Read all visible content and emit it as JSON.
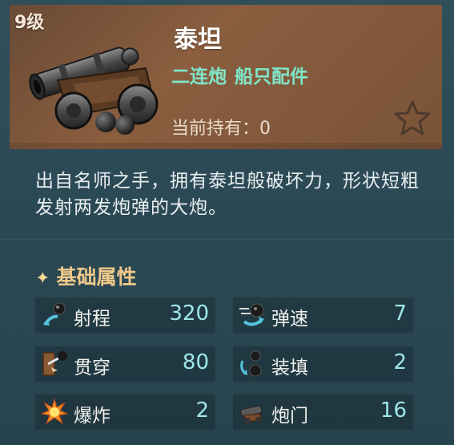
{
  "item": {
    "level": "9级",
    "name": "泰坦",
    "tags": [
      "二连炮",
      "船只配件"
    ],
    "owned_label": "当前持有：",
    "owned_value": "0"
  },
  "description": "出自名师之手，拥有泰坦般破坏力，形状短粗发射两发炮弹的大炮。",
  "attributes": {
    "title": "基础属性",
    "stats": [
      {
        "label": "射程",
        "value": "320",
        "icon": "range-icon"
      },
      {
        "label": "弹速",
        "value": "7",
        "icon": "projectile-speed-icon"
      },
      {
        "label": "贯穿",
        "value": "80",
        "icon": "penetration-icon"
      },
      {
        "label": "装填",
        "value": "2",
        "icon": "reload-icon"
      },
      {
        "label": "爆炸",
        "value": "2",
        "icon": "explosion-icon"
      },
      {
        "label": "炮门",
        "value": "16",
        "icon": "cannon-port-icon"
      }
    ]
  },
  "colors": {
    "background": "#2c4a55",
    "header": "#7a5338",
    "accent_green": "#7fe7c9",
    "section_gold": "#f0c98a",
    "stat_value": "#9fe6ea"
  }
}
